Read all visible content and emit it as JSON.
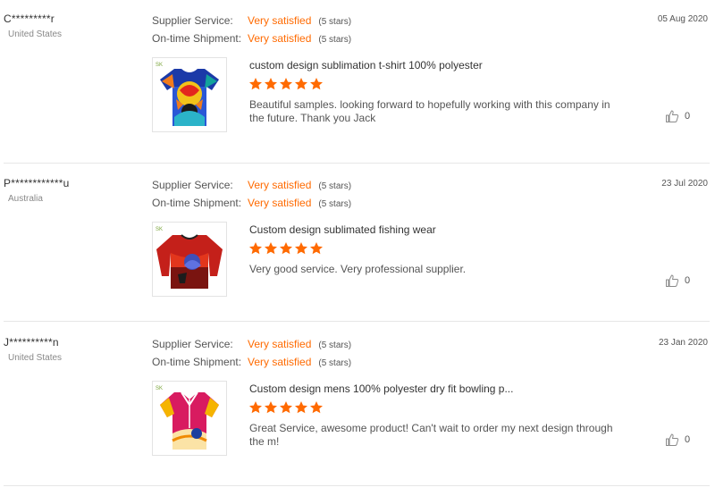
{
  "colors": {
    "accent": "#ff6a00",
    "star": "#ff6a00",
    "divider": "#e6e6e6"
  },
  "reviews": [
    {
      "buyer": "C*********r",
      "country": "United States",
      "date": "05 Aug 2020",
      "supplier_service": {
        "label": "Supplier Service:",
        "value": "Very satisfied",
        "stars": "(5 stars)"
      },
      "on_time_shipment": {
        "label": "On-time Shipment:",
        "value": "Very satisfied",
        "stars": "(5 stars)"
      },
      "product_title": "custom design sublimation t-shirt 100% polyester",
      "rating": 5,
      "text": "Beautiful samples. looking forward to hopefully working with this company in the future. Thank you Jack",
      "likes": "0",
      "thumb_icon": "colorful-tshirt-image"
    },
    {
      "buyer": "P************u",
      "country": "Australia",
      "date": "23 Jul 2020",
      "supplier_service": {
        "label": "Supplier Service:",
        "value": "Very satisfied",
        "stars": "(5 stars)"
      },
      "on_time_shipment": {
        "label": "On-time Shipment:",
        "value": "Very satisfied",
        "stars": "(5 stars)"
      },
      "product_title": "Custom design sublimated fishing wear",
      "rating": 5,
      "text": "Very good service. Very professional supplier.",
      "likes": "0",
      "thumb_icon": "red-fishing-shirt-image"
    },
    {
      "buyer": "J**********n",
      "country": "United States",
      "date": "23 Jan 2020",
      "supplier_service": {
        "label": "Supplier Service:",
        "value": "Very satisfied",
        "stars": "(5 stars)"
      },
      "on_time_shipment": {
        "label": "On-time Shipment:",
        "value": "Very satisfied",
        "stars": "(5 stars)"
      },
      "product_title": "Custom design mens 100% polyester dry fit bowling p...",
      "rating": 5,
      "text": "Great Service, awesome product! Can't wait to order my next design through the m!",
      "likes": "0",
      "thumb_icon": "bowling-shirt-image"
    }
  ]
}
